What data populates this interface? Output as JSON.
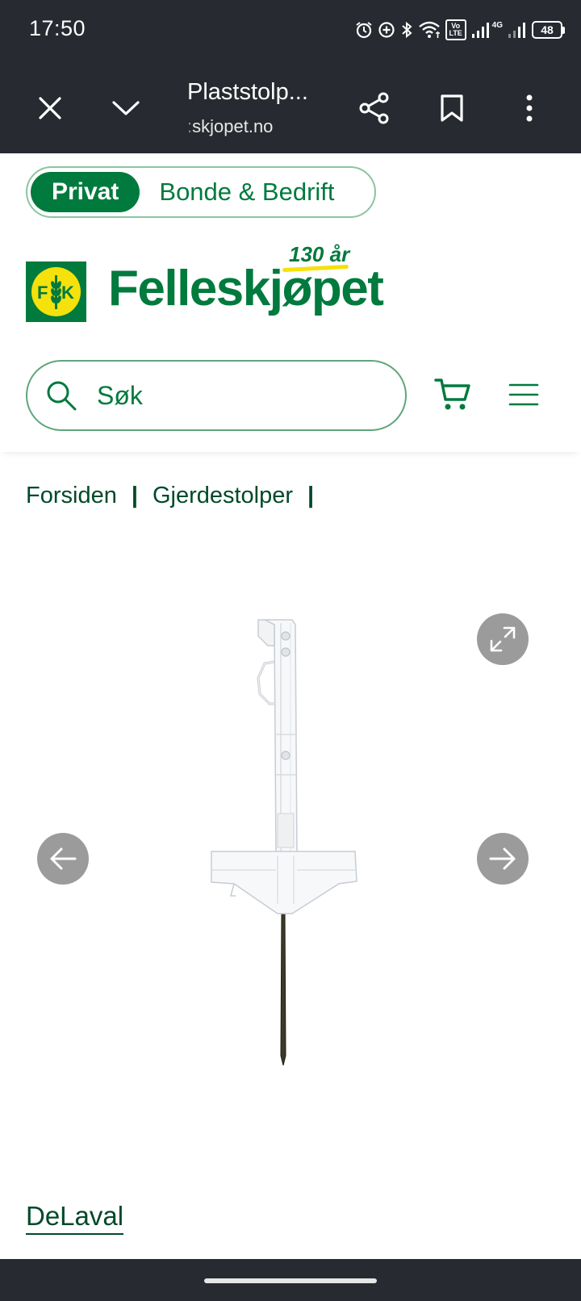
{
  "status_bar": {
    "time": "17:50",
    "network_label": "4G",
    "volte_label": "Vo LTE",
    "battery_level": "48",
    "icons": [
      "alarm-icon",
      "data-saver-icon",
      "bluetooth-icon",
      "wifi-icon",
      "volte-icon",
      "signal-icon",
      "signal-icon",
      "battery-icon"
    ]
  },
  "browser": {
    "page_title": "Plaststolp...",
    "url_prefix": ":",
    "url": "skjopet.no",
    "icons": [
      "close-icon",
      "chevron-down-icon",
      "share-icon",
      "bookmark-icon",
      "more-vert-icon"
    ]
  },
  "header": {
    "segment": {
      "active": "Privat",
      "inactive": "Bonde & Bedrift"
    },
    "logo": {
      "badge_left": "F",
      "badge_right": "K",
      "wordmark": "Felleskjøpet",
      "anniversary": "130 år"
    },
    "search": {
      "placeholder": "Søk"
    },
    "icons": [
      "search-icon",
      "cart-icon",
      "menu-icon"
    ],
    "brand_color": "#007a3d",
    "accent_color": "#f5e10b"
  },
  "breadcrumb": {
    "items": [
      "Forsiden",
      "Gjerdestolper"
    ],
    "separator": "|"
  },
  "gallery": {
    "icons": [
      "expand-icon",
      "arrow-left-icon",
      "arrow-right-icon"
    ]
  },
  "product": {
    "brand": "DeLaval"
  }
}
